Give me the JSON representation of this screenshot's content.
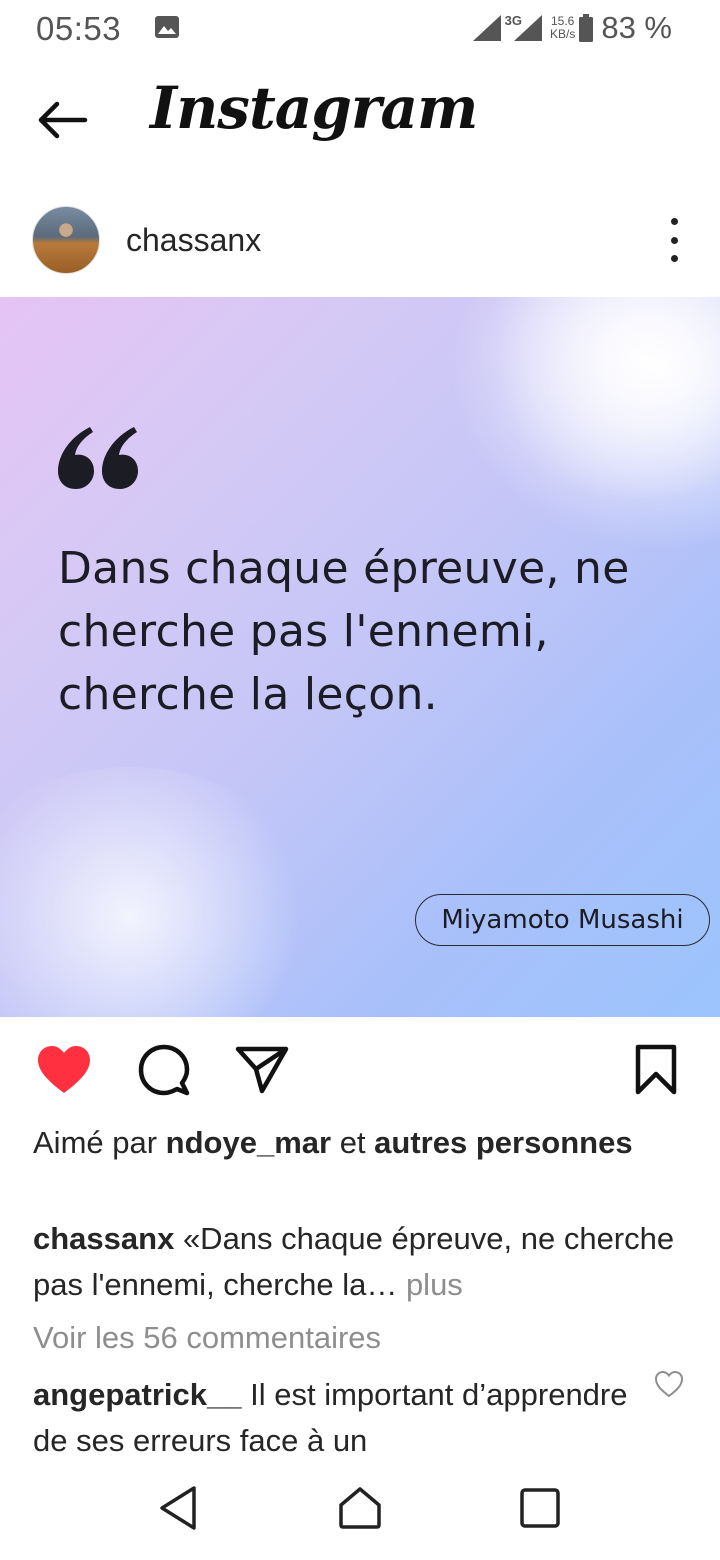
{
  "status_bar": {
    "time": "05:53",
    "network": "3G",
    "speed_value": "15.6",
    "speed_unit": "KB/s",
    "battery": "83 %",
    "icons": [
      "image-icon",
      "signal-icon",
      "signal-3g-icon",
      "battery-icon"
    ]
  },
  "header": {
    "back_icon": "arrow-left-icon",
    "app_name": "Instagram"
  },
  "post": {
    "username": "chassanx",
    "more_icon": "more-vertical-icon",
    "image": {
      "quote_lines": [
        "Dans chaque épreuve, ne",
        "cherche pas l'ennemi,",
        "cherche la leçon."
      ],
      "author": "Miyamoto Musashi",
      "colors": {
        "gradient_start": "#e6c4f5",
        "gradient_end": "#9cc4fd"
      }
    },
    "actions": {
      "like_icon": "heart-filled-icon",
      "comment_icon": "comment-icon",
      "share_icon": "paper-plane-icon",
      "save_icon": "bookmark-icon",
      "like_color": "#ff3040"
    },
    "likes": {
      "prefix": "Aimé par ",
      "user": "ndoye_mar",
      "middle": " et ",
      "suffix": "autres personnes"
    },
    "caption": {
      "username": "chassanx",
      "text": " «Dans chaque épreuve, ne cherche pas l'ennemi, cherche la…",
      "more": " plus"
    },
    "view_comments": "Voir les 56 commentaires",
    "comment": {
      "username": "angepatrick__",
      "text": " Il est important d’apprendre de ses erreurs face à un"
    }
  },
  "nav_bar": {
    "icons": [
      "nav-back-icon",
      "nav-home-icon",
      "nav-recent-icon"
    ]
  }
}
